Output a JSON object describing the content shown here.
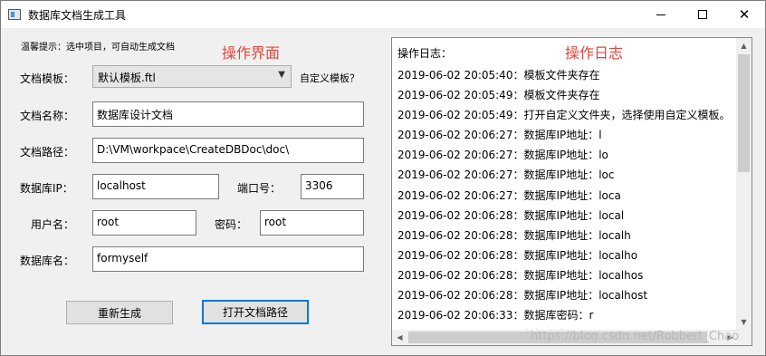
{
  "window": {
    "title": "数据库文档生成工具",
    "close_glyph": "✕"
  },
  "form": {
    "tip": "温馨提示：选中项目，可自动生成文档",
    "section_label": "操作界面",
    "template_label": "文档模板：",
    "template_value": "默认模板.ftl",
    "custom_template_label": "自定义模板？",
    "doc_name_label": "文档名称：",
    "doc_name_value": "数据库设计文档",
    "doc_path_label": "文档路径：",
    "doc_path_value": "D:\\VM\\workpace\\CreateDBDoc\\doc\\",
    "db_ip_label": "数据库IP：",
    "db_ip_value": "localhost",
    "port_label": "端口号：",
    "port_value": "3306",
    "username_label": "用户名：",
    "username_value": "root",
    "password_label": "密码：",
    "password_value": "root",
    "db_name_label": "数据库名：",
    "db_name_value": "formyself",
    "regenerate_button": "重新生成",
    "open_path_button": "打开文档路径"
  },
  "log": {
    "section_label": "操作日志",
    "header": "操作日志：",
    "lines": [
      "2019-06-02 20:05:40：模板文件夹存在",
      "2019-06-02 20:05:49：模板文件夹存在",
      "2019-06-02 20:05:49：打开自定义文件夹，选择使用自定义模板。",
      "2019-06-02 20:06:27：数据库IP地址：l",
      "2019-06-02 20:06:27：数据库IP地址：lo",
      "2019-06-02 20:06:27：数据库IP地址：loc",
      "2019-06-02 20:06:27：数据库IP地址：loca",
      "2019-06-02 20:06:28：数据库IP地址：local",
      "2019-06-02 20:06:28：数据库IP地址：localh",
      "2019-06-02 20:06:28：数据库IP地址：localho",
      "2019-06-02 20:06:28：数据库IP地址：localhos",
      "2019-06-02 20:06:28：数据库IP地址：localhost",
      "2019-06-02 20:06:33：数据库密码：r",
      "2019-06-02 20:06:33：数据库密码"
    ]
  },
  "watermark": "https://blog.csdn.net/Robbert_Chao"
}
